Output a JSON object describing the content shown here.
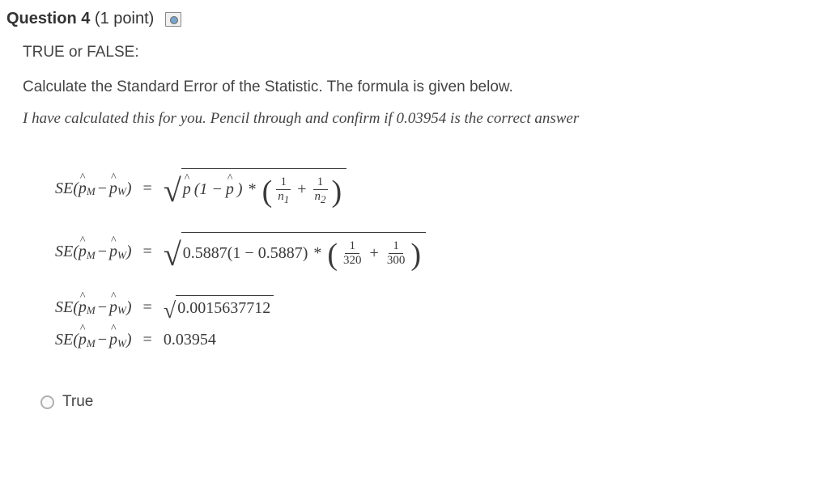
{
  "header": {
    "label": "Question",
    "number": "4",
    "points": "(1 point)"
  },
  "body": {
    "line1": "TRUE or FALSE:",
    "line2": "Calculate the Standard Error of the Statistic. The formula is given below.",
    "line3": "I have calculated this for you. Pencil through and confirm if 0.03954 is the correct answer"
  },
  "formula": {
    "lhs_prefix": "SE(",
    "phat": "p",
    "sub_m": "M",
    "minus": "−",
    "sub_w": "W",
    "lhs_suffix": ")",
    "equals": "=",
    "line1": {
      "p": "p",
      "open": "(1 − ",
      "close": " )",
      "times": "*",
      "frac1_num": "1",
      "frac1_den": "n",
      "frac1_sub": "1",
      "plus": "+",
      "frac2_num": "1",
      "frac2_den": "n",
      "frac2_sub": "2"
    },
    "line2": {
      "val1": "0.5887(1 − 0.5887)",
      "times": "*",
      "frac1_num": "1",
      "frac1_den": "320",
      "plus": "+",
      "frac2_num": "1",
      "frac2_den": "300"
    },
    "line3": {
      "radicand": "0.0015637712"
    },
    "line4": {
      "result": "0.03954"
    }
  },
  "options": {
    "true_label": "True"
  }
}
